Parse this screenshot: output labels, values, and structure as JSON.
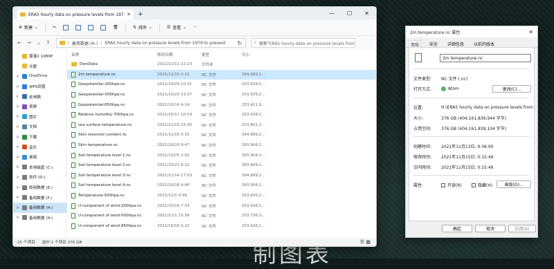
{
  "explorer": {
    "tab_title": "ERA5 hourly data on pressure levels from 1979 to present",
    "toolbar": {
      "new": "新建",
      "sort": "排序",
      "view": "查看"
    },
    "breadcrumb": [
      "备用数据 (H:)",
      "ERA5 hourly data on pressure levels from 1979 to present"
    ],
    "search_placeholder": "搜索\"ERA5 hourly data on pressure levels from 19...",
    "nav": [
      {
        "label": "毫港2 1080P",
        "chev": "",
        "color": "#e8b839"
      },
      {
        "label": "文献",
        "chev": "",
        "color": "#e8b839"
      },
      {
        "label": "OneDrive",
        "chev": ">",
        "color": "#2d7fd3"
      },
      {
        "label": "WPS同盘",
        "chev": ">",
        "color": "#2d7fd3"
      },
      {
        "label": "此电脑",
        "chev": "v",
        "color": "#3a6ea5"
      },
      {
        "label": "视频",
        "chev": ">",
        "color": "#7b4fb5"
      },
      {
        "label": "图片",
        "chev": ">",
        "color": "#2d9fd3"
      },
      {
        "label": "文档",
        "chev": ">",
        "color": "#5a7fa5"
      },
      {
        "label": "下载",
        "chev": ">",
        "color": "#2d8f3d"
      },
      {
        "label": "音乐",
        "chev": ">",
        "color": "#d34f2d"
      },
      {
        "label": "桌面",
        "chev": ">",
        "color": "#3a8fd3"
      },
      {
        "label": "本地磁盘 (C:)",
        "chev": ">",
        "color": "#7a7a7a"
      },
      {
        "label": "软件 (D:)",
        "chev": ">",
        "color": "#7a7a7a"
      },
      {
        "label": "即用数据 (E:)",
        "chev": ">",
        "color": "#7a7a7a"
      },
      {
        "label": "备用数据 (F:)",
        "chev": ">",
        "color": "#7a7a7a"
      },
      {
        "label": "备用数据 (H:)",
        "chev": ">",
        "color": "#7a7a7a",
        "selected": true
      },
      {
        "label": "备用数据 (H:)",
        "chev": ">",
        "color": "#7a7a7a"
      }
    ],
    "columns": {
      "name": "名称",
      "date": "修改日期",
      "type": "类型",
      "size": "大小"
    },
    "files": [
      {
        "name": "DwnData",
        "date": "2021/11/11 22:23",
        "type": "文件夹",
        "size": "",
        "folder": true
      },
      {
        "name": "2m temperature.nc",
        "date": "2021/11/15 0:15",
        "type": "NC 文件",
        "size": "394,689,2...",
        "selected": true
      },
      {
        "name": "Geopotential-200hpa.nc",
        "date": "2021/10/29 10:31",
        "type": "NC 文件",
        "size": "253,639,0..."
      },
      {
        "name": "Geopotential-500hpa.nc",
        "date": "2021/10/20 23:37",
        "type": "NC 文件",
        "size": "253,509,2..."
      },
      {
        "name": "Geopotential-850hpa.nc",
        "date": "2021/10/16 4:14",
        "type": "NC 文件",
        "size": "253,411,9..."
      },
      {
        "name": "Relative humidity-700hpa.nc",
        "date": "2021/10/17 10:19",
        "type": "NC 文件",
        "size": "253,428,1..."
      },
      {
        "name": "sea surface temperature.nc",
        "date": "2021/11/15 15:30",
        "type": "NC 文件",
        "size": "253,801,2..."
      },
      {
        "name": "Skin reservoir content.nc",
        "date": "2021/11/15 0:15",
        "type": "NC 文件",
        "size": "394,689,2..."
      },
      {
        "name": "Skin temperature.nc",
        "date": "2021/10/29 9:47",
        "type": "NC 文件",
        "size": "393,904,1..."
      },
      {
        "name": "Soil temperature level 1.nc",
        "date": "2021/10/25 2:02",
        "type": "NC 文件",
        "size": "393,904,1..."
      },
      {
        "name": "Soil temperature level 2.nc",
        "date": "2021/10/21 6:22",
        "type": "NC 文件",
        "size": "393,904,1..."
      },
      {
        "name": "Soil temperature level 3.nc",
        "date": "2021/11/14 17:03",
        "type": "NC 文件",
        "size": "394,689,2..."
      },
      {
        "name": "Soil temperature level 4.nc",
        "date": "2021/10/18 4:40",
        "type": "NC 文件",
        "size": "393,904,1..."
      },
      {
        "name": "Temperature-500hpa.nc",
        "date": "2021/11/1 0:56",
        "type": "NC 文件",
        "size": "253,655,2..."
      },
      {
        "name": "U-component of wind-200hpa.nc",
        "date": "2021/10/16 7:33",
        "type": "NC 文件",
        "size": "253,428,1..."
      },
      {
        "name": "U-component of wind-500hpa.nc",
        "date": "2021/11/1 15:58",
        "type": "NC 文件",
        "size": "253,736,3..."
      },
      {
        "name": "U-component of wind-850hpa.nc",
        "date": "2021/10/16 3:22",
        "type": "NC 文件",
        "size": "253,428,1..."
      }
    ],
    "status": {
      "count": "25 个项目",
      "selected": "选中 1 个项目  376 GB"
    }
  },
  "props": {
    "title": "2m temperature.nc 属性",
    "tabs": [
      "常规",
      "安全",
      "详细信息",
      "以前的版本"
    ],
    "filename": "2m temperature.nc",
    "type_label": "文件类型:",
    "type_value": "NC 文件 (.nc)",
    "open_label": "打开方式:",
    "open_value": "Atom",
    "change_button": "更改(C)...",
    "loc_label": "位置:",
    "loc_value": "H:\\ERA5 hourly data on pressure levels from 1979",
    "size_label": "大小:",
    "size_value": "376 GB (404,161,836,944 字节)",
    "disk_label": "占用空间:",
    "disk_value": "376 GB (404,161,839,104 字节)",
    "created_label": "创建时间:",
    "created_value": "2021年11月13日, 9:36:00",
    "modified_label": "修改时间:",
    "modified_value": "2021年11月15日, 0:15:49",
    "accessed_label": "访问时间:",
    "accessed_value": "2021年11月15日, 0:15:49",
    "attr_label": "属性:",
    "readonly": "只读(R)",
    "hidden": "隐藏(H)",
    "advanced": "高级(D)...",
    "ok": "确定",
    "cancel": "取消",
    "apply": "应用(A)"
  },
  "desktop": {
    "watermark": "制图表"
  }
}
